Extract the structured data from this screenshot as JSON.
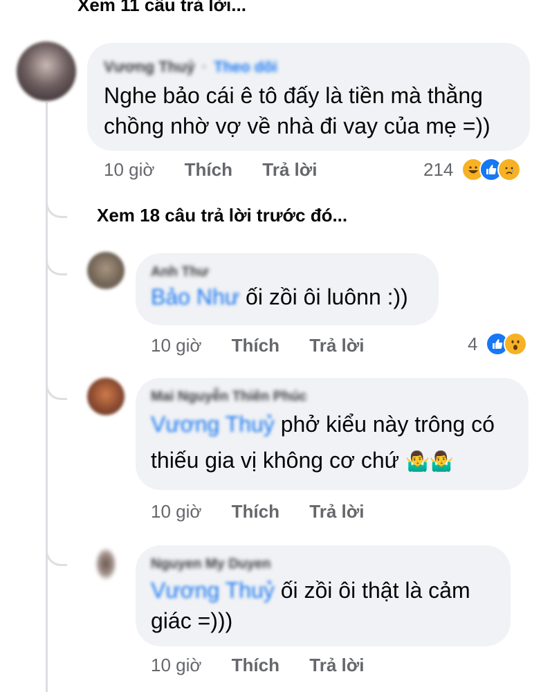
{
  "top_link": "Xem 11 câu trả lời...",
  "main_comment": {
    "author": "Vương Thuỷ",
    "separator": "·",
    "follow": "Theo dõi",
    "text_line1": "Nghe bảo cái ê tô đấy là tiền mà thằng",
    "text_line2": "chồng nhờ vợ về nhà đi vay của mẹ =))",
    "time": "10 giờ",
    "like": "Thích",
    "reply": "Trả lời",
    "reaction_count": "214",
    "reactions": [
      "haha-icon",
      "like-icon",
      "sad-icon"
    ]
  },
  "previous_replies_link": "Xem 18 câu trả lời trước đó...",
  "replies": [
    {
      "author": "Anh Thư",
      "mention": "Bảo Như",
      "text": "ối zồi ôi luônn :))",
      "time": "10 giờ",
      "like": "Thích",
      "reply": "Trả lời",
      "reaction_count": "4",
      "reactions": [
        "like-icon",
        "wow-icon"
      ]
    },
    {
      "author": "Mai Nguyễn Thiên Phúc",
      "mention": "Vương Thuỷ",
      "text_line1": "phở kiểu này trông có",
      "text_line2": "thiếu gia vị không cơ chứ",
      "emoji": "🤷‍♂️🤷‍♂️",
      "time": "10 giờ",
      "like": "Thích",
      "reply": "Trả lời"
    },
    {
      "author": "Nguyen My Duyen",
      "mention": "Vương Thuỷ",
      "text_line1": "ối zồi ôi thật là cảm",
      "text_line2": "giác =)))",
      "time": "10 giờ",
      "like": "Thích",
      "reply": "Trả lời"
    }
  ],
  "colors": {
    "bubble": "#f0f2f5",
    "link_blue": "#1877f2",
    "meta_gray": "#65676b",
    "thread_line": "#dcdee2"
  }
}
